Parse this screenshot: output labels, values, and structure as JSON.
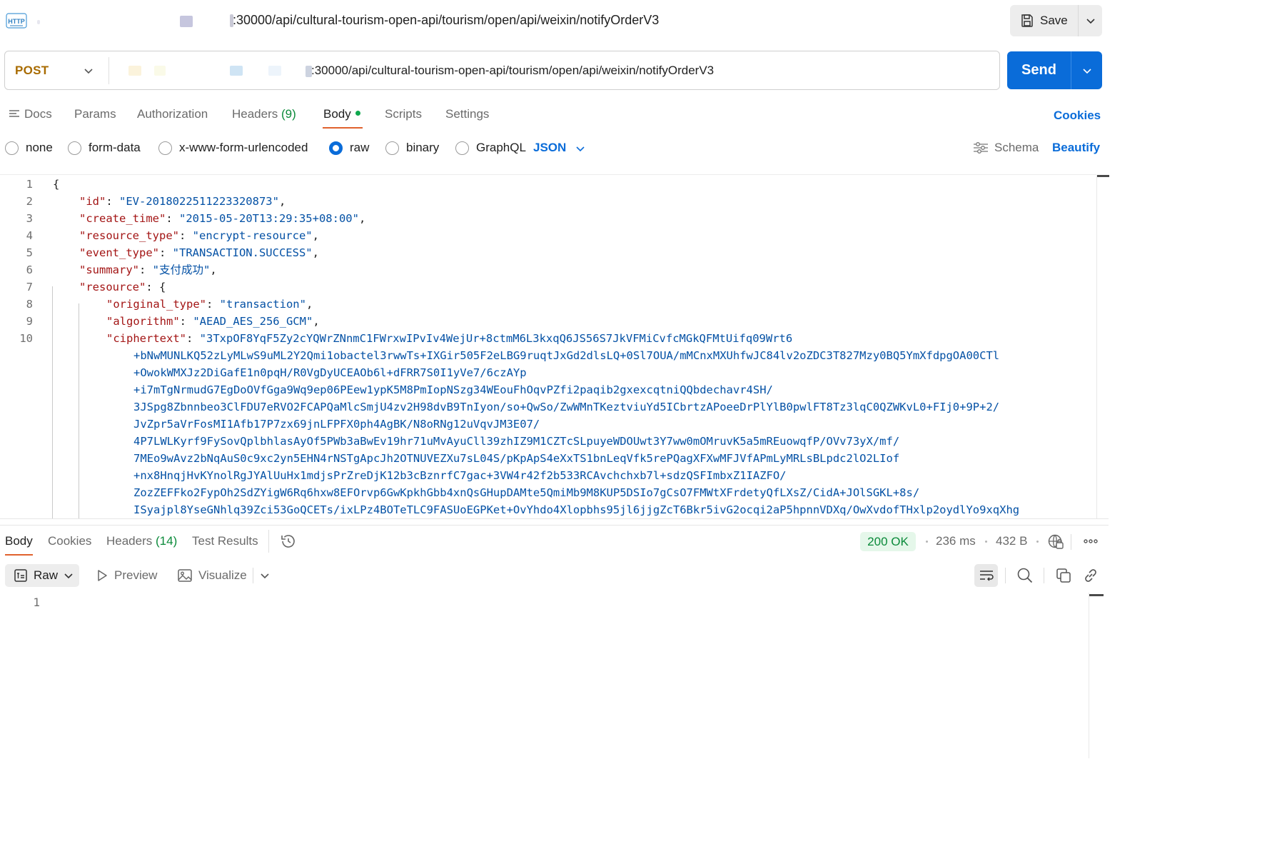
{
  "header": {
    "request_url": ":30000/api/cultural-tourism-open-api/tourism/open/api/weixin/notifyOrderV3",
    "http_icon_text": "HTTP",
    "save_label": "Save"
  },
  "request": {
    "method": "POST",
    "url": ":30000/api/cultural-tourism-open-api/tourism/open/api/weixin/notifyOrderV3",
    "send_label": "Send"
  },
  "request_tabs": {
    "docs": "Docs",
    "params": "Params",
    "authorization": "Authorization",
    "headers": "Headers",
    "headers_count": "(9)",
    "body": "Body",
    "scripts": "Scripts",
    "settings": "Settings",
    "cookies": "Cookies"
  },
  "body_types": {
    "none": "none",
    "form_data": "form-data",
    "urlencoded": "x-www-form-urlencoded",
    "raw": "raw",
    "binary": "binary",
    "graphql": "GraphQL",
    "selected": "raw",
    "format": "JSON",
    "schema": "Schema",
    "beautify": "Beautify"
  },
  "editor": {
    "line_numbers": [
      "1",
      "2",
      "3",
      "4",
      "5",
      "6",
      "7",
      "8",
      "9",
      "10"
    ],
    "line1": "{",
    "id_key": "\"id\"",
    "id_val": "\"EV-2018022511223320873\"",
    "create_time_key": "\"create_time\"",
    "create_time_val": "\"2015-05-20T13:29:35+08:00\"",
    "resource_type_key": "\"resource_type\"",
    "resource_type_val": "\"encrypt-resource\"",
    "event_type_key": "\"event_type\"",
    "event_type_val": "\"TRANSACTION.SUCCESS\"",
    "summary_key": "\"summary\"",
    "summary_val": "\"支付成功\"",
    "resource_key": "\"resource\"",
    "resource_open": "{",
    "original_type_key": "\"original_type\"",
    "original_type_val": "\"transaction\"",
    "algorithm_key": "\"algorithm\"",
    "algorithm_val": "\"AEAD_AES_256_GCM\"",
    "ciphertext_key": "\"ciphertext\"",
    "ciphertext_lines": [
      "\"3TxpOF8YqF5Zy2cYQWrZNnmC1FWrxwIPvIv4WejUr+8ctmM6L3kxqQ6JS56S7JkVFMiCvfcMGkQFMtUifq09Wrt6",
      "+bNwMUNLKQ52zLyMLwS9uML2Y2Qmi1obactel3rwwTs+IXGir505F2eLBG9ruqtJxGd2dlsLQ+0Sl7OUA/mMCnxMXUhfwJC84lv2oZDC3T827Mzy0BQ5YmXfdpgOA00CTl",
      "+OwokWMXJz2DiGafE1n0pqH/R0VgDyUCEAOb6l+dFRR7S0I1yVe7/6czAYp",
      "+i7mTgNrmudG7EgDoOVfGga9Wq9ep06PEew1ypK5M8PmIopNSzg34WEouFhOqvPZfi2paqib2gxexcqtniQQbdechavr4SH/",
      "3JSpg8Zbnnbeo3ClFDU7eRVO2FCAPQaMlcSmjU4zv2H98dvB9TnIyon/so+QwSo/ZwWMnTKeztviuYd5ICbrtzAPoeeDrPlYlB0pwlFT8Tz3lqC0QZWKvL0+FIj0+9P+2/",
      "JvZpr5aVrFosMI1Afb17P7zx69jnLFPFX0ph4AgBK/N8oRNg12uVqvJM3E07/",
      "4P7LWLKyrf9FySovQplbhlasAyOf5PWb3aBwEv19hr71uMvAyuCll39zhIZ9M1CZTcSLpuyeWDOUwt3Y7ww0mOMruvK5a5mREuowqfP/OVv73yX/mf/",
      "7MEo9wAvz2bNqAuS0c9xc2yn5EHN4rNSTgApcJh2OTNUVEZXu7sL04S/pKpApS4eXxTS1bnLeqVfk5rePQagXFXwMFJVfAPmLyMRLsBLpdc2lO2LIof",
      "+nx8HnqjHvKYnolRgJYAlUuHx1mdjsPrZreDjK12b3cBznrfC7gac+3VW4r42f2b533RCAvchchxb7l+sdzQSFImbxZ1IAZFO/",
      "ZozZEFFko2FypOh2SdZYigW6Rq6hxw8EFOrvp6GwKpkhGbb4xnQsGHupDAMte5QmiMb9M8KUP5DSIo7gCsO7FMWtXFrdetyQfLXsZ/CidA+JOlSGKL+8s/",
      "ISyajpl8YseGNhlq39Zci53GoQCETs/ixLPz4BOTeTLC9FASUoEGPKet+OvYhdo4Xlopbhs95jl6jjgZcT6Bkr5ivG2ocqi2aP5hpnnVDXq/OwXvdofTHxlp2oydlYo9xqXhg"
    ]
  },
  "response": {
    "tabs": {
      "body": "Body",
      "cookies": "Cookies",
      "headers": "Headers",
      "headers_count": "(14)",
      "test_results": "Test Results"
    },
    "status": "200 OK",
    "time": "236 ms",
    "size": "432 B",
    "view_mode": "Raw",
    "preview": "Preview",
    "visualize": "Visualize",
    "line_numbers": [
      "1"
    ]
  },
  "colors": {
    "accent": "#0a6cd9",
    "method": "#a86b00",
    "json_key": "#a31515",
    "json_string": "#0451a5",
    "status_ok": "#0b8a3a",
    "tab_underline": "#e0622e"
  },
  "icons": {
    "http": "http-icon",
    "save": "floppy-disk-icon",
    "docs": "docs-lines-icon",
    "schema": "sliders-icon",
    "history": "history-icon",
    "network": "globe-lock-icon",
    "more": "more-dots-icon",
    "raw": "raw-text-icon",
    "preview": "play-icon",
    "visualize": "image-icon",
    "wrap": "word-wrap-icon",
    "search": "search-icon",
    "copy": "copy-icon",
    "link": "link-icon"
  }
}
